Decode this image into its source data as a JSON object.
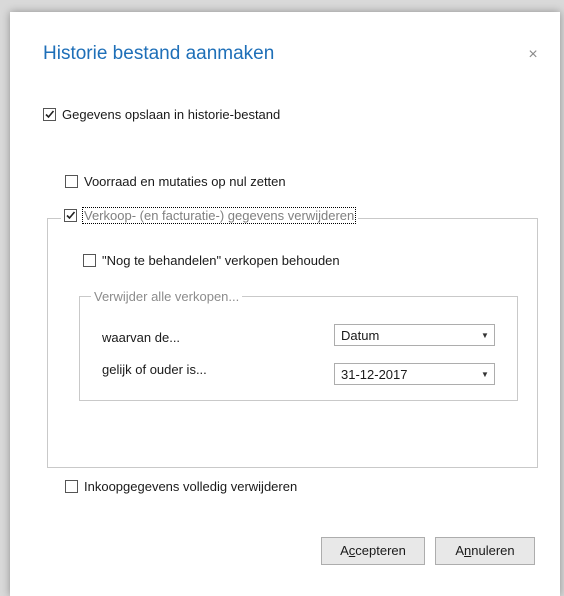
{
  "dialog": {
    "title": "Historie bestand aanmaken",
    "close_glyph": "×"
  },
  "options": {
    "save_history": {
      "label": "Gegevens opslaan in historie-bestand",
      "checked": true
    },
    "zero_stock": {
      "label": "Voorraad en mutaties op nul zetten",
      "checked": false
    },
    "delete_sales": {
      "label": "Verkoop- (en facturatie-) gegevens verwijderen",
      "checked": true
    },
    "keep_pending": {
      "label": "\"Nog te behandelen\" verkopen behouden",
      "checked": false
    },
    "delete_purchase": {
      "label": "Inkoopgegevens volledig verwijderen",
      "checked": false
    }
  },
  "delete_all_group": {
    "legend": "Verwijder alle verkopen...",
    "where_label": "waarvan de...",
    "where_value": "Datum",
    "older_label": "gelijk of ouder is...",
    "older_value": "31-12-2017"
  },
  "buttons": {
    "accept": {
      "before": "A",
      "underlined": "c",
      "after": "cepteren"
    },
    "cancel": {
      "before": "A",
      "underlined": "n",
      "after": "nuleren"
    }
  },
  "colors": {
    "title": "#1e6fb8",
    "disabled_text": "#808080"
  }
}
